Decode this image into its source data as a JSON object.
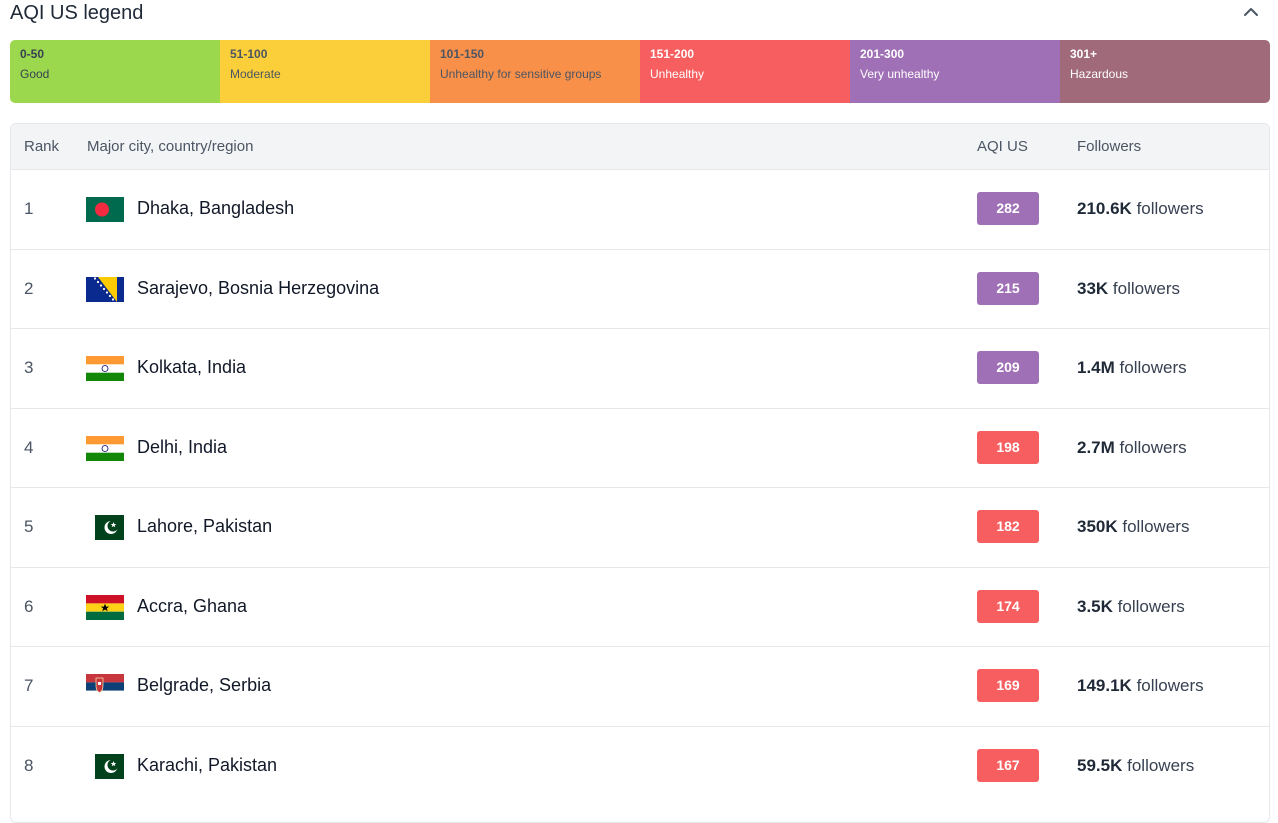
{
  "legend": {
    "title": "AQI US legend",
    "toggle_icon": "chevron-up-icon",
    "segments": [
      {
        "range": "0-50",
        "label": "Good",
        "bg": "#9cd84e",
        "fg": "#374151"
      },
      {
        "range": "51-100",
        "label": "Moderate",
        "bg": "#facf39",
        "fg": "#4b5563"
      },
      {
        "range": "101-150",
        "label": "Unhealthy for sensitive groups",
        "bg": "#f99049",
        "fg": "#4b5563"
      },
      {
        "range": "151-200",
        "label": "Unhealthy",
        "bg": "#f65e5f",
        "fg": "#ffffff"
      },
      {
        "range": "201-300",
        "label": "Very unhealthy",
        "bg": "#a070b6",
        "fg": "#ffffff"
      },
      {
        "range": "301+",
        "label": "Hazardous",
        "bg": "#a06a7b",
        "fg": "#ffffff"
      }
    ]
  },
  "table": {
    "headers": {
      "rank": "Rank",
      "city": "Major city, country/region",
      "aqi": "AQI US",
      "followers": "Followers"
    },
    "followers_suffix": "followers",
    "rows": [
      {
        "rank": "1",
        "city": "Dhaka, Bangladesh",
        "flag": "bangladesh-flag-icon",
        "aqi": "282",
        "aqi_color": "#a070b6",
        "followers": "210.6K"
      },
      {
        "rank": "2",
        "city": "Sarajevo, Bosnia Herzegovina",
        "flag": "bosnia-flag-icon",
        "aqi": "215",
        "aqi_color": "#a070b6",
        "followers": "33K"
      },
      {
        "rank": "3",
        "city": "Kolkata, India",
        "flag": "india-flag-icon",
        "aqi": "209",
        "aqi_color": "#a070b6",
        "followers": "1.4M"
      },
      {
        "rank": "4",
        "city": "Delhi, India",
        "flag": "india-flag-icon",
        "aqi": "198",
        "aqi_color": "#f65e5f",
        "followers": "2.7M"
      },
      {
        "rank": "5",
        "city": "Lahore, Pakistan",
        "flag": "pakistan-flag-icon",
        "aqi": "182",
        "aqi_color": "#f65e5f",
        "followers": "350K"
      },
      {
        "rank": "6",
        "city": "Accra, Ghana",
        "flag": "ghana-flag-icon",
        "aqi": "174",
        "aqi_color": "#f65e5f",
        "followers": "3.5K"
      },
      {
        "rank": "7",
        "city": "Belgrade, Serbia",
        "flag": "serbia-flag-icon",
        "aqi": "169",
        "aqi_color": "#f65e5f",
        "followers": "149.1K"
      },
      {
        "rank": "8",
        "city": "Karachi, Pakistan",
        "flag": "pakistan-flag-icon",
        "aqi": "167",
        "aqi_color": "#f65e5f",
        "followers": "59.5K"
      }
    ]
  }
}
